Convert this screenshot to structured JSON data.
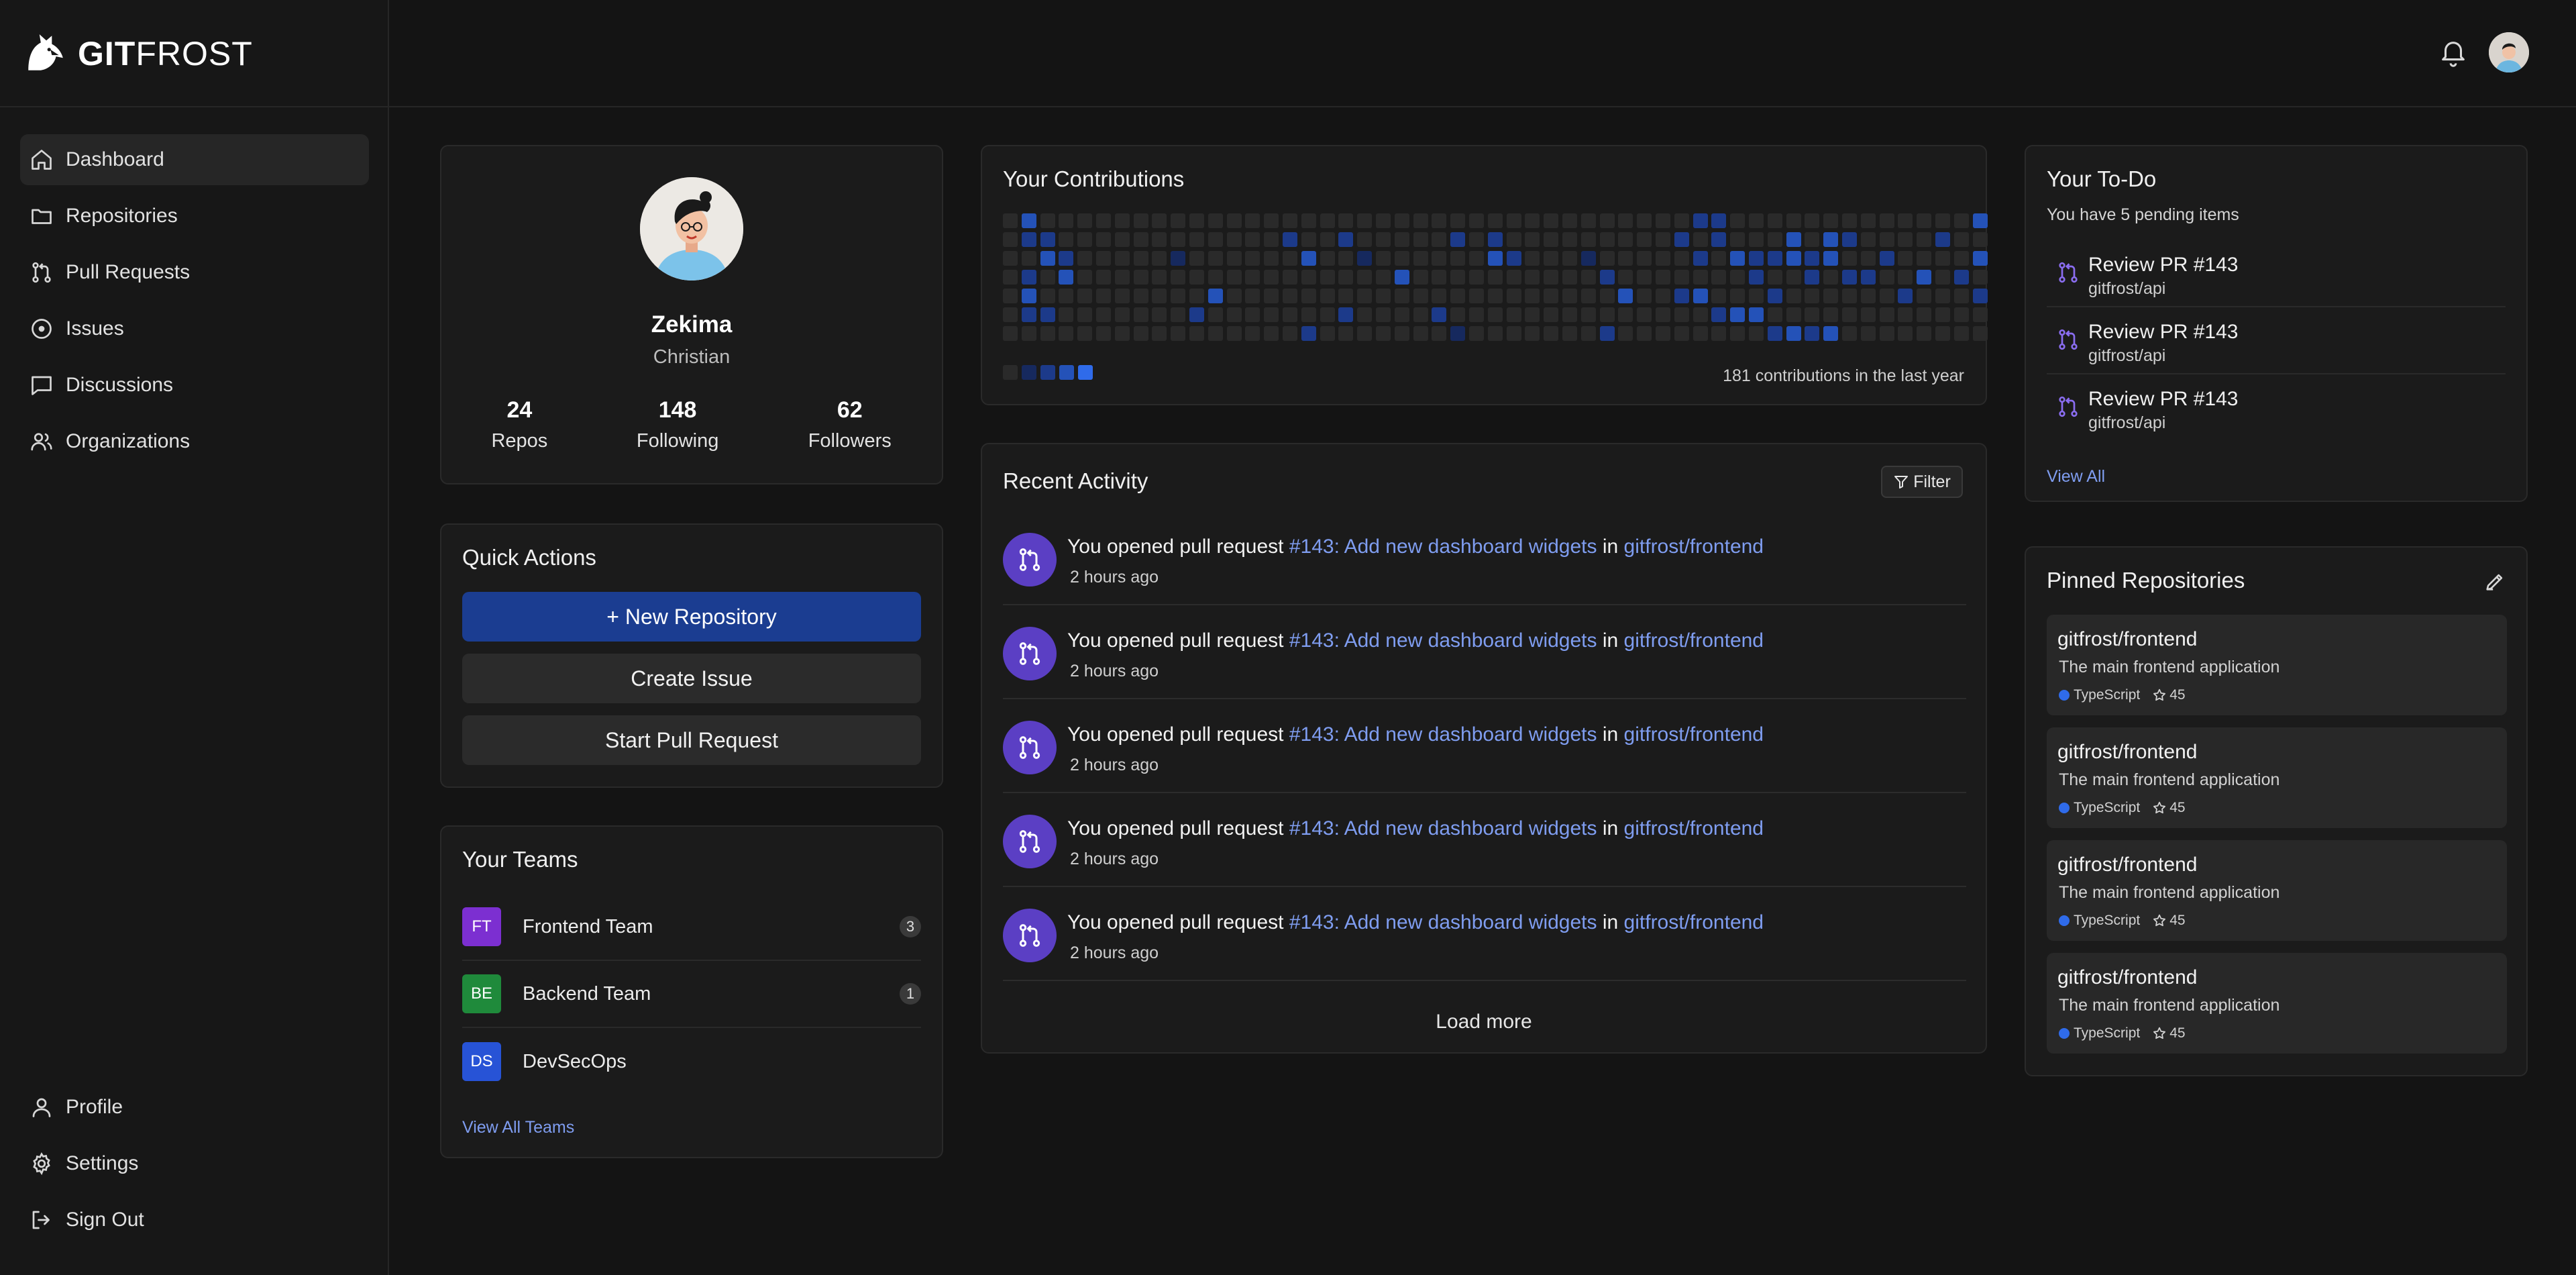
{
  "app": {
    "brand_bold": "GIT",
    "brand_light": "FROST"
  },
  "sidebar": {
    "items": [
      {
        "label": "Dashboard",
        "icon": "home-icon"
      },
      {
        "label": "Repositories",
        "icon": "folder-icon"
      },
      {
        "label": "Pull Requests",
        "icon": "pull-request-icon"
      },
      {
        "label": "Issues",
        "icon": "issue-icon"
      },
      {
        "label": "Discussions",
        "icon": "discussion-icon"
      },
      {
        "label": "Organizations",
        "icon": "organization-icon"
      }
    ],
    "bottom_items": [
      {
        "label": "Profile",
        "icon": "user-icon"
      },
      {
        "label": "Settings",
        "icon": "gear-icon"
      },
      {
        "label": "Sign Out",
        "icon": "sign-out-icon"
      }
    ]
  },
  "profile": {
    "name": "Zekima",
    "subtitle": "Christian",
    "stats": [
      {
        "value": "24",
        "label": "Repos"
      },
      {
        "value": "148",
        "label": "Following"
      },
      {
        "value": "62",
        "label": "Followers"
      }
    ]
  },
  "quick_actions": {
    "title": "Quick Actions",
    "new_repo": "+ New Repository",
    "create_issue": "Create Issue",
    "start_pr": "Start Pull Request"
  },
  "teams": {
    "title": "Your Teams",
    "items": [
      {
        "initials": "FT",
        "name": "Frontend Team",
        "count": "3",
        "color": "#7c2fd1"
      },
      {
        "initials": "BE",
        "name": "Backend Team",
        "count": "1",
        "color": "#1f8a3b"
      },
      {
        "initials": "DS",
        "name": "DevSecOps",
        "count": "",
        "color": "#2753d6"
      }
    ],
    "view_all": "View All Teams"
  },
  "contributions": {
    "title": "Your Contributions",
    "summary": "181 contributions in the last year",
    "colors": [
      "#2a2a2a",
      "#16295e",
      "#1c3a8a",
      "#2452b8",
      "#2f6bea"
    ],
    "weeks": 53,
    "days": 7,
    "active_cells": [
      [
        1,
        0,
        3
      ],
      [
        1,
        1,
        2
      ],
      [
        1,
        3,
        2
      ],
      [
        1,
        4,
        3
      ],
      [
        1,
        5,
        2
      ],
      [
        2,
        1,
        2
      ],
      [
        2,
        2,
        3
      ],
      [
        2,
        5,
        2
      ],
      [
        3,
        2,
        2
      ],
      [
        3,
        3,
        3
      ],
      [
        9,
        2,
        1
      ],
      [
        10,
        5,
        2
      ],
      [
        11,
        4,
        3
      ],
      [
        15,
        1,
        2
      ],
      [
        16,
        2,
        3
      ],
      [
        16,
        6,
        2
      ],
      [
        18,
        1,
        2
      ],
      [
        18,
        5,
        2
      ],
      [
        19,
        2,
        1
      ],
      [
        21,
        3,
        3
      ],
      [
        23,
        5,
        2
      ],
      [
        24,
        1,
        2
      ],
      [
        24,
        6,
        1
      ],
      [
        26,
        1,
        2
      ],
      [
        26,
        2,
        3
      ],
      [
        27,
        2,
        2
      ],
      [
        31,
        2,
        1
      ],
      [
        32,
        3,
        2
      ],
      [
        32,
        6,
        2
      ],
      [
        33,
        4,
        3
      ],
      [
        36,
        1,
        2
      ],
      [
        36,
        4,
        2
      ],
      [
        37,
        0,
        2
      ],
      [
        37,
        2,
        2
      ],
      [
        37,
        4,
        3
      ],
      [
        38,
        0,
        2
      ],
      [
        38,
        1,
        2
      ],
      [
        38,
        5,
        2
      ],
      [
        39,
        2,
        3
      ],
      [
        39,
        5,
        3
      ],
      [
        40,
        2,
        2
      ],
      [
        40,
        3,
        2
      ],
      [
        40,
        5,
        3
      ],
      [
        41,
        2,
        2
      ],
      [
        41,
        4,
        2
      ],
      [
        41,
        6,
        2
      ],
      [
        42,
        1,
        3
      ],
      [
        42,
        2,
        3
      ],
      [
        42,
        6,
        3
      ],
      [
        43,
        2,
        2
      ],
      [
        43,
        3,
        2
      ],
      [
        43,
        6,
        2
      ],
      [
        44,
        1,
        3
      ],
      [
        44,
        2,
        3
      ],
      [
        44,
        6,
        3
      ],
      [
        45,
        1,
        2
      ],
      [
        45,
        3,
        2
      ],
      [
        46,
        3,
        2
      ],
      [
        47,
        2,
        2
      ],
      [
        48,
        4,
        2
      ],
      [
        49,
        3,
        3
      ],
      [
        50,
        1,
        2
      ],
      [
        51,
        3,
        2
      ],
      [
        52,
        0,
        3
      ],
      [
        52,
        2,
        3
      ],
      [
        52,
        4,
        2
      ]
    ]
  },
  "activity": {
    "title": "Recent Activity",
    "filter_label": "Filter",
    "items": [
      {
        "prefix": "You opened pull request ",
        "pr": "#143: Add new dashboard widgets",
        "mid": " in ",
        "repo": "gitfrost/frontend",
        "time": "2 hours ago"
      },
      {
        "prefix": "You opened pull request ",
        "pr": "#143: Add new dashboard widgets",
        "mid": " in ",
        "repo": "gitfrost/frontend",
        "time": "2 hours ago"
      },
      {
        "prefix": "You opened pull request ",
        "pr": "#143: Add new dashboard widgets",
        "mid": " in ",
        "repo": "gitfrost/frontend",
        "time": "2 hours ago"
      },
      {
        "prefix": "You opened pull request ",
        "pr": "#143: Add new dashboard widgets",
        "mid": " in ",
        "repo": "gitfrost/frontend",
        "time": "2 hours ago"
      },
      {
        "prefix": "You opened pull request ",
        "pr": "#143: Add new dashboard widgets",
        "mid": " in ",
        "repo": "gitfrost/frontend",
        "time": "2 hours ago"
      }
    ],
    "load_more": "Load more"
  },
  "todo": {
    "title": "Your To-Do",
    "subtitle": "You have 5 pending items",
    "items": [
      {
        "title": "Review PR #143",
        "repo": "gitfrost/api"
      },
      {
        "title": "Review PR #143",
        "repo": "gitfrost/api"
      },
      {
        "title": "Review PR #143",
        "repo": "gitfrost/api"
      }
    ],
    "view_all": "View All"
  },
  "pinned": {
    "title": "Pinned Repositories",
    "items": [
      {
        "name": "gitfrost/frontend",
        "description": "The main frontend application",
        "language": "TypeScript",
        "stars": "45"
      },
      {
        "name": "gitfrost/frontend",
        "description": "The main frontend application",
        "language": "TypeScript",
        "stars": "45"
      },
      {
        "name": "gitfrost/frontend",
        "description": "The main frontend application",
        "language": "TypeScript",
        "stars": "45"
      },
      {
        "name": "gitfrost/frontend",
        "description": "The main frontend application",
        "language": "TypeScript",
        "stars": "45"
      }
    ]
  }
}
